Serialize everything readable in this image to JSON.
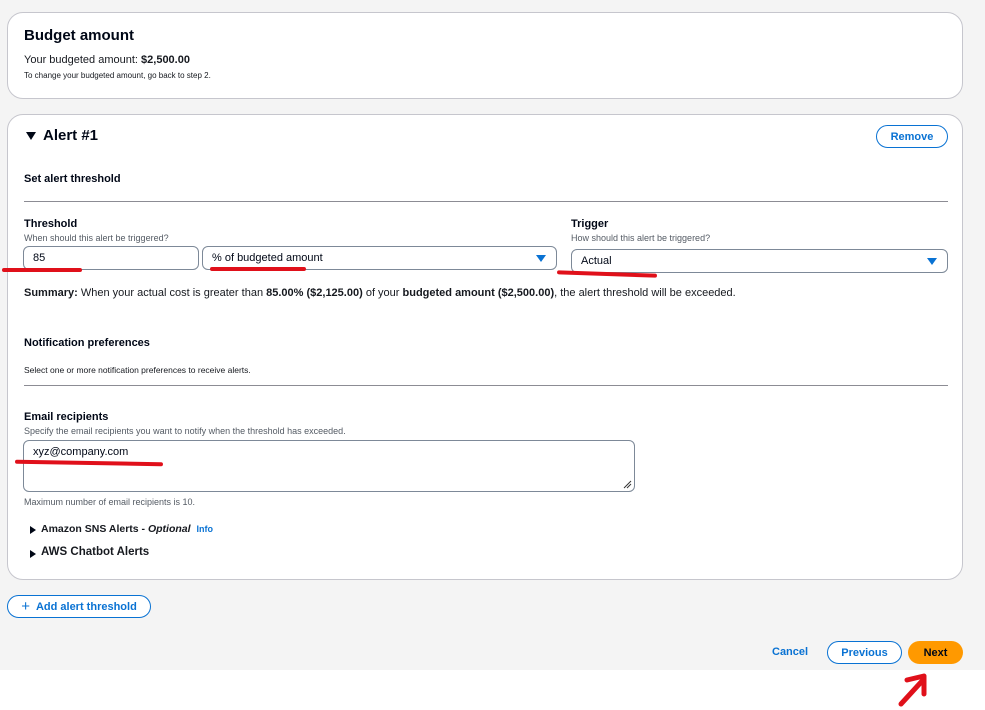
{
  "budget": {
    "title": "Budget amount",
    "amount_prefix": "Your budgeted amount: ",
    "amount_value": "$2,500.00",
    "hint": "To change your budgeted amount, go back to step 2."
  },
  "alert": {
    "title": "Alert #1",
    "remove_label": "Remove",
    "section_title": "Set alert threshold",
    "threshold": {
      "label": "Threshold",
      "hint": "When should this alert be triggered?",
      "value": "85",
      "unit_selected": "% of budgeted amount"
    },
    "trigger": {
      "label": "Trigger",
      "hint": "How should this alert be triggered?",
      "selected": "Actual"
    },
    "summary": {
      "prefix": "Summary:",
      "part1": " When your actual cost is greater than ",
      "pct": "85.00% ($2,125.00)",
      "part2": " of your ",
      "budget": "budgeted amount ($2,500.00)",
      "part3": ", the alert threshold will be exceeded."
    },
    "notifications": {
      "title": "Notification preferences",
      "hint": "Select one or more notification preferences to receive alerts."
    },
    "email": {
      "label": "Email recipients",
      "hint": "Specify the email recipients you want to notify when the threshold has exceeded.",
      "value": "xyz@company.com",
      "max_hint": "Maximum number of email recipients is 10."
    },
    "sns": {
      "label": "Amazon SNS Alerts - ",
      "optional": "Optional",
      "info": "Info"
    },
    "chatbot": {
      "label": "AWS Chatbot Alerts"
    }
  },
  "add_threshold_label": "Add alert threshold",
  "footer": {
    "cancel": "Cancel",
    "previous": "Previous",
    "next": "Next"
  },
  "colors": {
    "link": "#0972d3",
    "primary": "#ff9900",
    "annotation": "#e0101a"
  }
}
